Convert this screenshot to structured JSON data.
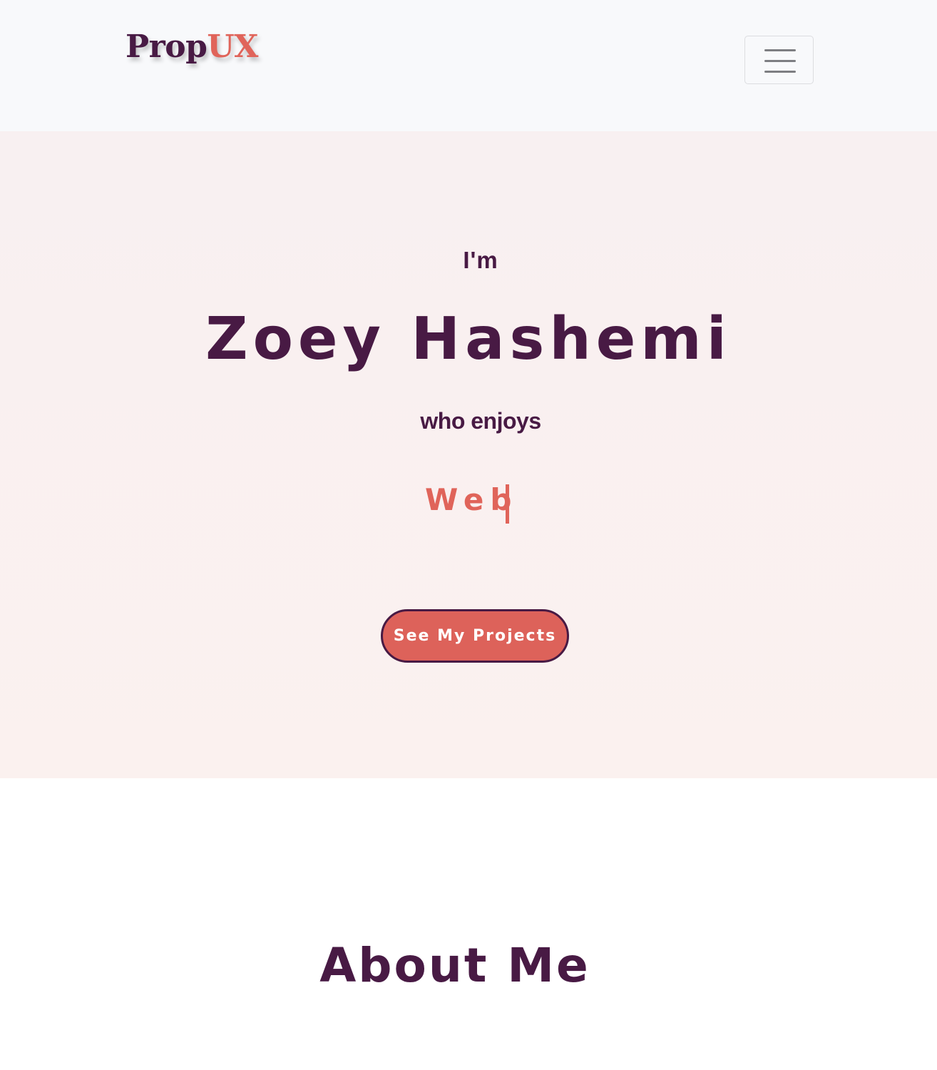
{
  "navbar": {
    "brand_part1": "Prop",
    "brand_part2": "UX",
    "menu_button_aria": "Toggle navigation"
  },
  "hero": {
    "intro": "I'm",
    "name": "Zoey Hashemi",
    "enjoys": "who enjoys",
    "typed_text": "Web",
    "cta_label": "See My Projects"
  },
  "about": {
    "heading": "About Me"
  },
  "colors": {
    "primary": "#481a44",
    "accent": "#e0645a",
    "button_bg": "#dd625a",
    "navbar_bg": "#f8f9fb",
    "hero_bg": "#f9f0f0"
  },
  "icons": {
    "menu": "hamburger-icon"
  }
}
